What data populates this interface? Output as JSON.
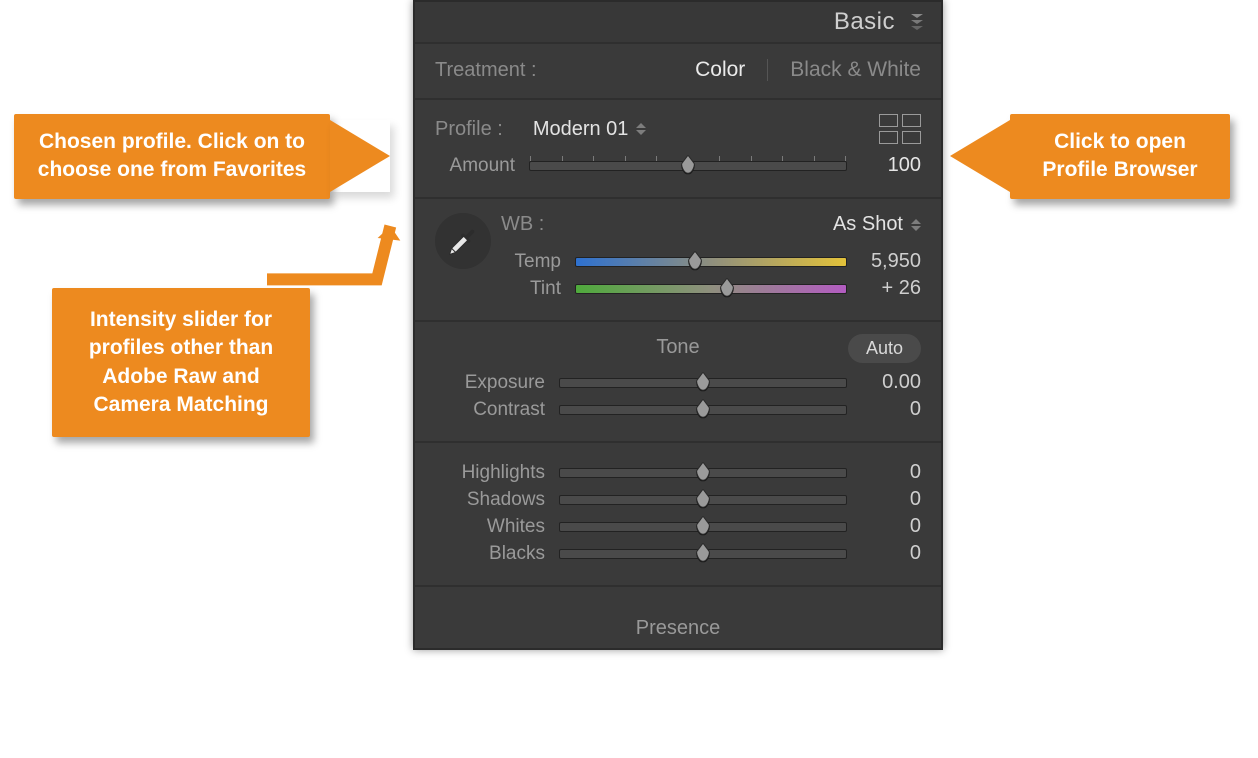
{
  "panel": {
    "title": "Basic"
  },
  "treatment": {
    "label": "Treatment :",
    "color": "Color",
    "bw": "Black & White",
    "active": "color"
  },
  "profile": {
    "label": "Profile :",
    "value": "Modern 01",
    "amount_label": "Amount",
    "amount_value": "100",
    "amount_pos": 0.5
  },
  "wb": {
    "label": "WB :",
    "value": "As Shot",
    "temp_label": "Temp",
    "temp_value": "5,950",
    "temp_pos": 0.44,
    "tint_label": "Tint",
    "tint_value": "+ 26",
    "tint_pos": 0.56
  },
  "tone": {
    "title": "Tone",
    "auto": "Auto",
    "sliders": [
      {
        "label": "Exposure",
        "value": "0.00",
        "pos": 0.5
      },
      {
        "label": "Contrast",
        "value": "0",
        "pos": 0.5
      }
    ],
    "sliders2": [
      {
        "label": "Highlights",
        "value": "0",
        "pos": 0.5
      },
      {
        "label": "Shadows",
        "value": "0",
        "pos": 0.5
      },
      {
        "label": "Whites",
        "value": "0",
        "pos": 0.5
      },
      {
        "label": "Blacks",
        "value": "0",
        "pos": 0.5
      }
    ]
  },
  "presence": {
    "title": "Presence"
  },
  "callouts": {
    "profile": "Chosen profile. Click on to choose one from Favorites",
    "amount": "Intensity slider for profiles other than Adobe Raw and Camera Matching",
    "browser": "Click to open Profile Browser"
  }
}
